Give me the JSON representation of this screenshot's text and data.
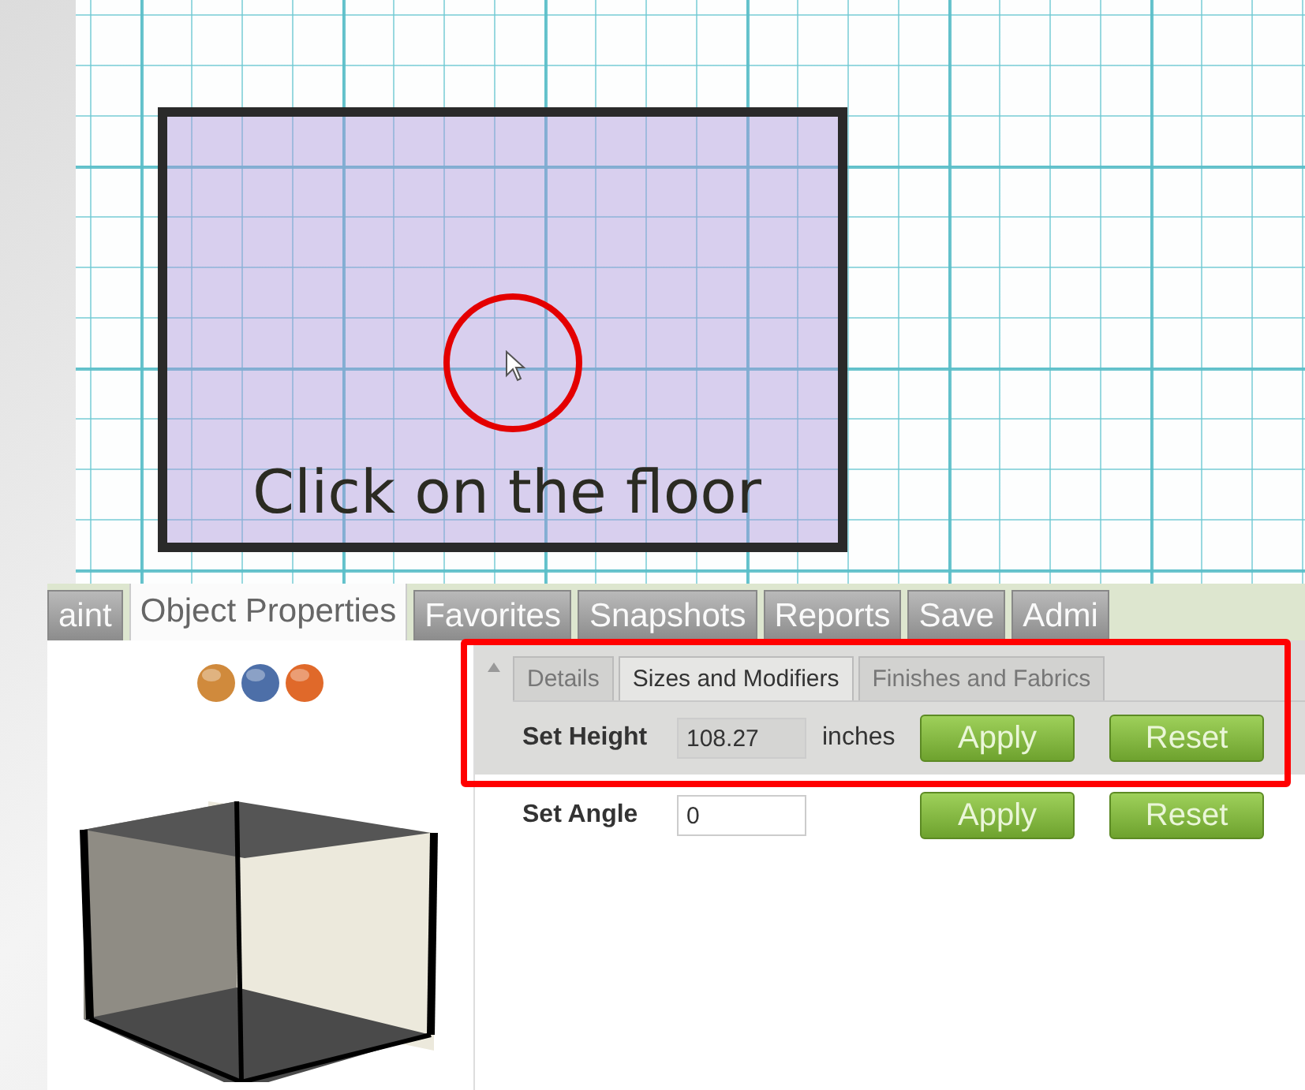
{
  "canvas": {
    "callout": "Click on the floor"
  },
  "tabs": [
    {
      "label": "aint",
      "selected": false
    },
    {
      "label": "Object Properties",
      "selected": true
    },
    {
      "label": "Favorites",
      "selected": false
    },
    {
      "label": "Snapshots",
      "selected": false
    },
    {
      "label": "Reports",
      "selected": false
    },
    {
      "label": "Save",
      "selected": false
    },
    {
      "label": "Admi",
      "selected": false
    }
  ],
  "sub_tabs": [
    {
      "label": "Details",
      "selected": false
    },
    {
      "label": "Sizes and Modifiers",
      "selected": true
    },
    {
      "label": "Finishes and Fabrics",
      "selected": false
    }
  ],
  "rows": [
    {
      "label": "Set Height",
      "value": "108.27",
      "unit": "inches",
      "buttons": [
        "Apply",
        "Reset"
      ]
    },
    {
      "label": "Set Angle",
      "value": "0",
      "buttons": [
        "Apply",
        "Reset"
      ]
    }
  ]
}
